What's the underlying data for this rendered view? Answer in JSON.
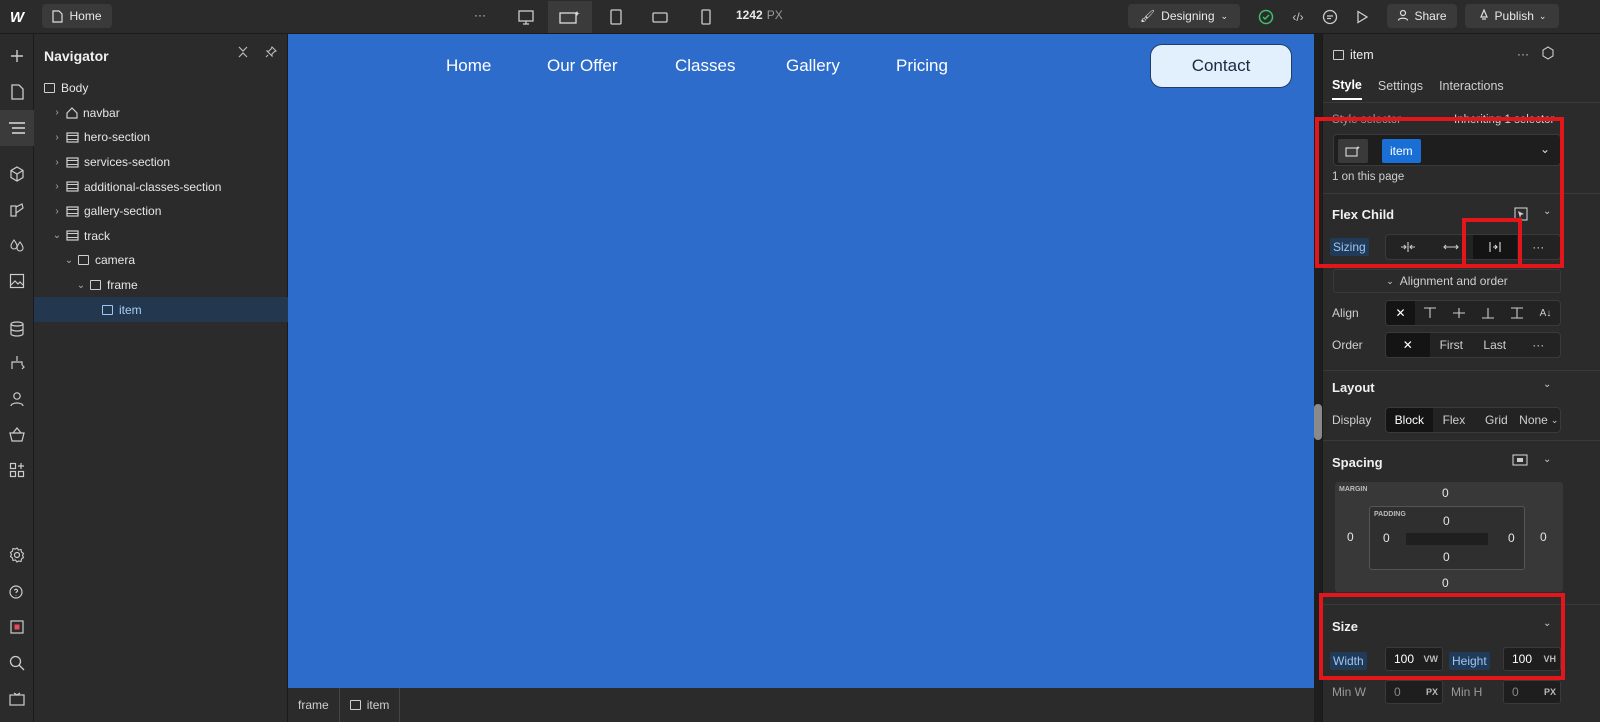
{
  "topbar": {
    "page_label": "Home",
    "more_label": "···",
    "width_value": "1242",
    "width_unit": "PX",
    "mode_label": "Designing",
    "share_label": "Share",
    "publish_label": "Publish"
  },
  "navigator": {
    "title": "Navigator",
    "items": [
      {
        "label": "Body",
        "depth": 0,
        "chevron": "",
        "icon": "box"
      },
      {
        "label": "navbar",
        "depth": 1,
        "chevron": "›",
        "icon": "house"
      },
      {
        "label": "hero-section",
        "depth": 1,
        "chevron": "›",
        "icon": "section"
      },
      {
        "label": "services-section",
        "depth": 1,
        "chevron": "›",
        "icon": "section"
      },
      {
        "label": "additional-classes-section",
        "depth": 1,
        "chevron": "›",
        "icon": "section"
      },
      {
        "label": "gallery-section",
        "depth": 1,
        "chevron": "›",
        "icon": "section"
      },
      {
        "label": "track",
        "depth": 1,
        "chevron": "⌄",
        "icon": "section"
      },
      {
        "label": "camera",
        "depth": 2,
        "chevron": "⌄",
        "icon": "box"
      },
      {
        "label": "frame",
        "depth": 3,
        "chevron": "⌄",
        "icon": "box"
      },
      {
        "label": "item",
        "depth": 4,
        "chevron": "",
        "icon": "box",
        "selected": true
      }
    ]
  },
  "canvas": {
    "menu": [
      "Home",
      "Our Offer",
      "Classes",
      "Gallery",
      "Pricing"
    ],
    "contact_label": "Contact"
  },
  "breadcrumb": [
    "frame",
    "item"
  ],
  "style_panel": {
    "element_name": "item",
    "tabs": [
      "Style",
      "Settings",
      "Interactions"
    ],
    "selector_label": "Style selector",
    "inheriting_label": "Inheriting 1 selector",
    "class_chip": "item",
    "on_page": "1 on this page",
    "flex_child": {
      "title": "Flex Child",
      "sizing_label": "Sizing",
      "more": "···",
      "alignment_toggle": "Alignment and order",
      "align_label": "Align",
      "order_label": "Order",
      "order_options": [
        "First",
        "Last"
      ]
    },
    "layout": {
      "title": "Layout",
      "display_label": "Display",
      "options": [
        "Block",
        "Flex",
        "Grid",
        "None"
      ],
      "selected": "Block"
    },
    "spacing": {
      "title": "Spacing",
      "margin_label": "MARGIN",
      "padding_label": "PADDING",
      "margin": {
        "top": "0",
        "right": "0",
        "bottom": "0",
        "left": "0"
      },
      "padding": {
        "top": "0",
        "right": "0",
        "bottom": "0",
        "left": "0"
      }
    },
    "size": {
      "title": "Size",
      "width_label": "Width",
      "width_value": "100",
      "width_unit": "VW",
      "height_label": "Height",
      "height_value": "100",
      "height_unit": "VH",
      "min_w_label": "Min W",
      "min_w_value": "0",
      "min_w_unit": "PX",
      "min_h_label": "Min H",
      "min_h_value": "0",
      "min_h_unit": "PX"
    }
  },
  "colors": {
    "canvas_bg": "#2d6ccb",
    "accent": "#1a6fd6",
    "highlight": "#e3161b"
  }
}
